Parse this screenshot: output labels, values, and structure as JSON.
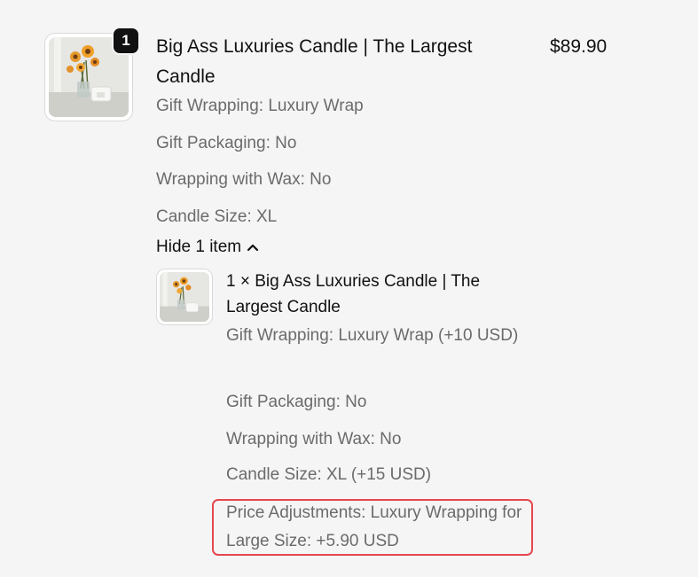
{
  "item": {
    "quantity_badge": "1",
    "title": "Big Ass Luxuries Candle | The Largest Candle",
    "price": "$89.90",
    "options": [
      "Gift Wrapping: Luxury Wrap",
      "Gift Packaging: No",
      "Wrapping with Wax: No",
      "Candle Size: XL"
    ],
    "toggle_label": "Hide 1 item"
  },
  "sub_item": {
    "title": "1 × Big Ass Luxuries Candle | The Largest Candle",
    "options": [
      "Gift Wrapping: Luxury Wrap (+10 USD)",
      "Gift Packaging: No",
      "Wrapping with Wax: No",
      "Candle Size: XL (+15 USD)"
    ],
    "price_adjustment": "Price Adjustments: Luxury Wrapping for Large Size: +5.90 USD"
  },
  "colors": {
    "highlight": "#e5484d",
    "muted_text": "#6b6b6b",
    "badge_bg": "#111111"
  }
}
